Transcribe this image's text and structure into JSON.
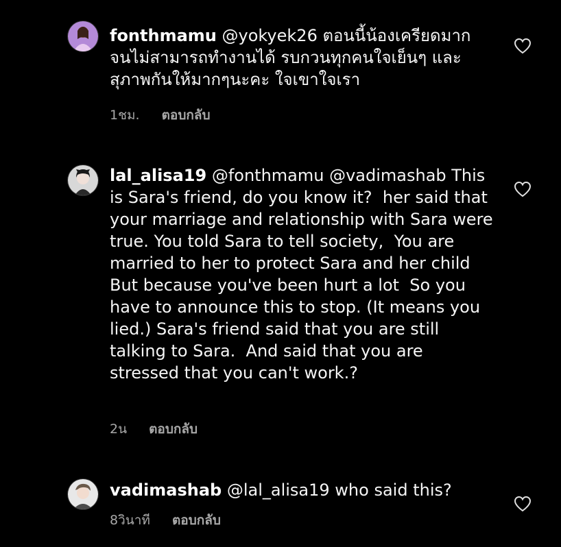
{
  "comments": [
    {
      "username": "fonthmamu",
      "text": " @yokyek26 ตอนนี้น้องเครียดมาก จนไม่สามารถทำงานได้ รบกวนทุกคนใจเย็นๆ และสุภาพกันให้มากๆนะคะ ใจเขาใจเรา",
      "time": "1ชม.",
      "reply_label": "ตอบกลับ",
      "avatar_icon": "profile-photo"
    },
    {
      "username": "lal_alisa19",
      "text": " @fonthmamu @vadimashab This is Sara's friend, do you know it?  her said that your marriage and relationship with Sara were true. You told Sara to tell society,  You are married to her to protect Sara and her child  But because you've been hurt a lot  So you have to announce this to stop. (It means you lied.) Sara's friend said that you are still talking to Sara.  And said that you are stressed that you can't work.?",
      "time": "2น",
      "reply_label": "ตอบกลับ",
      "avatar_icon": "profile-photo"
    },
    {
      "username": "vadimashab",
      "text": " @lal_alisa19 who said this?",
      "time": "8วินาที",
      "reply_label": "ตอบกลับ",
      "avatar_icon": "profile-photo"
    }
  ],
  "icons": {
    "like": "heart-outline-icon"
  },
  "colors": {
    "background": "#000000",
    "text": "#f5f5f5",
    "secondary": "#a8a8a8"
  }
}
